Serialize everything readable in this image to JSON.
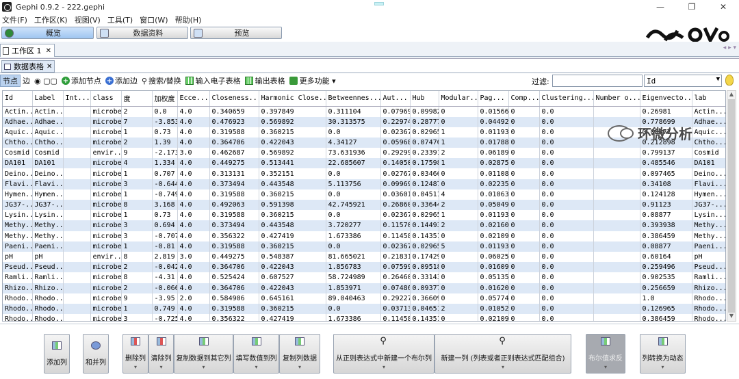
{
  "window": {
    "title": "Gephi 0.9.2 - 222.gephi",
    "minimize": "—",
    "maximize": "❐",
    "close": "✕"
  },
  "menu": [
    "文件(F)",
    "工作区(K)",
    "视图(V)",
    "工具(T)",
    "窗口(W)",
    "帮助(H)"
  ],
  "modes": [
    "概览",
    "数据资料",
    "预览"
  ],
  "workspace_tab": {
    "label": "工作区 1",
    "close": "✕",
    "arrows": "◂ ▸ ▾"
  },
  "panel_tab": {
    "label": "数据表格",
    "close": "✕"
  },
  "toolbar": {
    "nodes": "节点",
    "edges": "边",
    "add_node": "添加节点",
    "add_edge": "添加边",
    "search_replace": "搜索/替换",
    "import_spreadsheet": "输入电子表格",
    "export_table": "输出表格",
    "more_actions": "更多功能",
    "more_arrow": "▾",
    "filter_label": "过滤:",
    "filter_value": "",
    "filter_column": "Id"
  },
  "table": {
    "headers": [
      "Id",
      "Label",
      "Int...",
      "class",
      "度",
      "加权度",
      "Ecce...",
      "Closeness...",
      "Harmonic Close...",
      "Betweennes...",
      "Aut...",
      "Hub",
      "Modular...",
      "Pag...",
      "Comp...",
      "Clustering...",
      "Number o...",
      "Eigenvecto...",
      "lab"
    ],
    "rows": [
      [
        "Actin...",
        "Actin...",
        "",
        "microbe",
        "2",
        "0.0",
        "4.0",
        "0.340659",
        "0.397849",
        "0.311104",
        "0.079693",
        "0.099821",
        "0",
        "0.015664",
        "0",
        "0.0",
        "",
        "0.26981",
        "Actin..."
      ],
      [
        "Adhae...",
        "Adhae...",
        "",
        "microbe",
        "7",
        "-3.853",
        "4.0",
        "0.476923",
        "0.569892",
        "30.313575",
        "0.229749",
        "0.287776",
        "0",
        "0.044929",
        "0",
        "0.0",
        "",
        "0.778699",
        "Adhae..."
      ],
      [
        "Aquic...",
        "Aquic...",
        "",
        "microbe",
        "1",
        "0.73",
        "4.0",
        "0.319588",
        "0.360215",
        "0.0",
        "0.023671",
        "0.02965",
        "1",
        "0.011938",
        "0",
        "0.0",
        "",
        "0.08877",
        "Aquic..."
      ],
      [
        "Chtho...",
        "Chtho...",
        "",
        "microbe",
        "2",
        "1.39",
        "4.0",
        "0.364706",
        "0.422043",
        "4.34127",
        "0.059687",
        "0.074762",
        "1",
        "0.017881",
        "0",
        "0.0",
        "",
        "0.212898",
        "Chtho..."
      ],
      [
        "Cosmid",
        "Cosmid",
        "",
        "envir...",
        "9",
        "-2.173",
        "3.0",
        "0.462687",
        "0.569892",
        "73.631936",
        "0.292995",
        "0.233916",
        "2",
        "0.06189",
        "0",
        "0.0",
        "",
        "0.799137",
        "Cosmid"
      ],
      [
        "DA101",
        "DA101",
        "",
        "microbe",
        "4",
        "1.334",
        "4.0",
        "0.449275",
        "0.513441",
        "22.685607",
        "0.140502",
        "0.175988",
        "1",
        "0.028755",
        "0",
        "0.0",
        "",
        "0.485546",
        "DA101"
      ],
      [
        "Deino...",
        "Deino...",
        "",
        "microbe",
        "1",
        "0.707",
        "4.0",
        "0.313131",
        "0.352151",
        "0.0",
        "0.027672",
        "0.034661",
        "0",
        "0.011084",
        "0",
        "0.0",
        "",
        "0.097465",
        "Deino..."
      ],
      [
        "Flavi...",
        "Flavi...",
        "",
        "microbe",
        "3",
        "-0.644",
        "4.0",
        "0.373494",
        "0.443548",
        "5.113756",
        "0.099697",
        "0.124876",
        "0",
        "0.022352",
        "0",
        "0.0",
        "",
        "0.34108",
        "Flavi..."
      ],
      [
        "Hymen...",
        "Hymen...",
        "",
        "microbe",
        "1",
        "-0.749",
        "4.0",
        "0.319588",
        "0.360215",
        "0.0",
        "0.036016",
        "0.045112",
        "4",
        "0.010631",
        "0",
        "0.0",
        "",
        "0.124128",
        "Hymen..."
      ],
      [
        "JG37-...",
        "JG37-...",
        "",
        "microbe",
        "8",
        "3.168",
        "4.0",
        "0.492063",
        "0.591398",
        "42.745921",
        "0.268602",
        "0.336441",
        "2",
        "0.050499",
        "0",
        "0.0",
        "",
        "0.91123",
        "JG37-..."
      ],
      [
        "Lysin...",
        "Lysin...",
        "",
        "microbe",
        "1",
        "0.73",
        "4.0",
        "0.319588",
        "0.360215",
        "0.0",
        "0.023671",
        "0.02965",
        "1",
        "0.011938",
        "0",
        "0.0",
        "",
        "0.08877",
        "Lysin..."
      ],
      [
        "Methy...",
        "Methy...",
        "",
        "microbe",
        "3",
        "0.694",
        "4.0",
        "0.373494",
        "0.443548",
        "3.720277",
        "0.115709",
        "0.144933",
        "2",
        "0.021608",
        "0",
        "0.0",
        "",
        "0.393938",
        "Methy..."
      ],
      [
        "Methy...",
        "Methy...",
        "",
        "microbe",
        "3",
        "-0.707",
        "4.0",
        "0.356322",
        "0.427419",
        "1.673386",
        "0.11458",
        "0.143519",
        "0",
        "0.021092",
        "0",
        "0.0",
        "",
        "0.386459",
        "Methy..."
      ],
      [
        "Paeni...",
        "Paeni...",
        "",
        "microbe",
        "1",
        "-0.81",
        "4.0",
        "0.319588",
        "0.360215",
        "0.0",
        "0.023671",
        "0.02965",
        "5",
        "0.011938",
        "0",
        "0.0",
        "",
        "0.08877",
        "Paeni..."
      ],
      [
        "pH",
        "pH",
        "",
        "envir...",
        "8",
        "2.819",
        "3.0",
        "0.449275",
        "0.548387",
        "81.665021",
        "0.218317",
        "0.174296",
        "0",
        "0.06025",
        "0",
        "0.0",
        "",
        "0.60164",
        "pH"
      ],
      [
        "Pseud...",
        "Pseud...",
        "",
        "microbe",
        "2",
        "-0.042",
        "4.0",
        "0.364706",
        "0.422043",
        "1.856783",
        "0.07599",
        "0.095182",
        "0",
        "0.016097",
        "0",
        "0.0",
        "",
        "0.259496",
        "Pseud..."
      ],
      [
        "Ramli...",
        "Ramli...",
        "",
        "microbe",
        "8",
        "-4.31",
        "4.0",
        "0.525424",
        "0.607527",
        "58.724989",
        "0.264601",
        "0.33143",
        "0",
        "0.051352",
        "0",
        "0.0",
        "",
        "0.902535",
        "Ramli..."
      ],
      [
        "Rhizo...",
        "Rhizo...",
        "",
        "microbe",
        "2",
        "-0.066",
        "4.0",
        "0.364706",
        "0.422043",
        "1.853971",
        "0.074868",
        "0.093777",
        "0",
        "0.016201",
        "0",
        "0.0",
        "",
        "0.256659",
        "Rhizo..."
      ],
      [
        "Rhodo...",
        "Rhodo...",
        "",
        "microbe",
        "9",
        "-3.95",
        "2.0",
        "0.584906",
        "0.645161",
        "89.040463",
        "0.292273",
        "0.366091",
        "0",
        "0.057749",
        "0",
        "0.0",
        "",
        "1.0",
        "Rhodo..."
      ],
      [
        "Rhodo...",
        "Rhodo...",
        "",
        "microbe",
        "1",
        "0.749",
        "4.0",
        "0.319588",
        "0.360215",
        "0.0",
        "0.037137",
        "0.046517",
        "2",
        "0.010528",
        "0",
        "0.0",
        "",
        "0.126965",
        "Rhodo..."
      ],
      [
        "Rhodo...",
        "Rhodo...",
        "",
        "microbe",
        "3",
        "-0.725",
        "4.0",
        "0.356322",
        "0.427419",
        "1.673386",
        "0.11458",
        "0.143519",
        "0",
        "0.021092",
        "0",
        "0.0",
        "",
        "0.386459",
        "Rhodo..."
      ]
    ]
  },
  "bottom_buttons": [
    {
      "label": "添加列",
      "sub": ""
    },
    {
      "label": "和并列",
      "sub": ""
    },
    {
      "label": "删除列",
      "sub": "▾"
    },
    {
      "label": "清除列",
      "sub": "▾"
    },
    {
      "label": "复制数据到其它列",
      "sub": "▾"
    },
    {
      "label": "填写数值到列",
      "sub": "▾"
    },
    {
      "label": "复制列数据",
      "sub": "▾"
    },
    {
      "label": "从正则表达式中新建一个布尔列",
      "sub": "▾"
    },
    {
      "label": "新建一列 (列表或者正则表达式匹配组合)",
      "sub": "▾"
    },
    {
      "label": "布尔值求反",
      "sub": "▾"
    },
    {
      "label": "列转换为动态",
      "sub": "▾"
    }
  ],
  "watermark": "环微分析"
}
